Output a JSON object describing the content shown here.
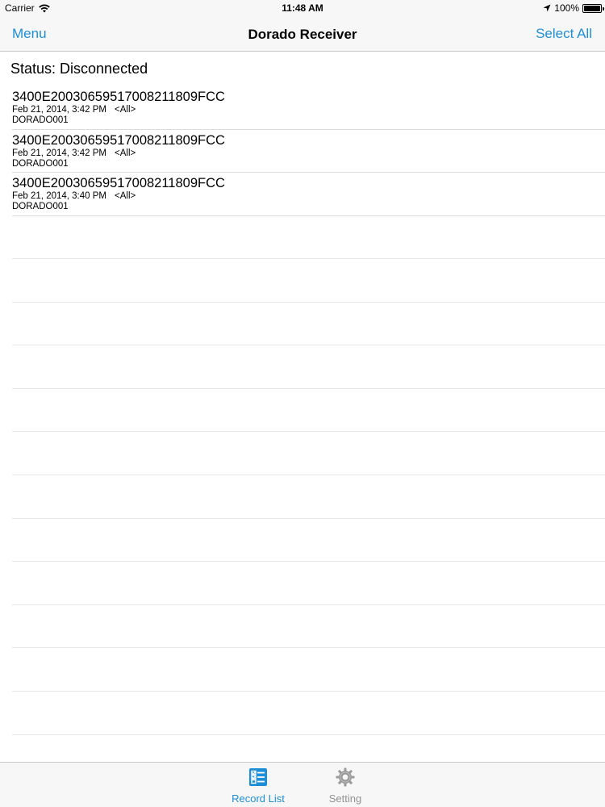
{
  "statusbar": {
    "carrier": "Carrier",
    "time": "11:48 AM",
    "battery": "100%",
    "battery_level": 1.0
  },
  "navbar": {
    "left_label": "Menu",
    "title": "Dorado Receiver",
    "right_label": "Select All"
  },
  "status_line": "Status: Disconnected",
  "records": [
    {
      "id": "3400E2003065951700821​1809FCC",
      "datetime": "Feb 21, 2014, 3:42 PM",
      "tag": "<All>",
      "device": "DORADO001"
    },
    {
      "id": "3400E20030659517008211809FCC",
      "datetime": "Feb 21, 2014, 3:42 PM",
      "tag": "<All>",
      "device": "DORADO001"
    },
    {
      "id": "3400E20030659517008211809FCC",
      "datetime": "Feb 21, 2014, 3:40 PM",
      "tag": "<All>",
      "device": "DORADO001"
    }
  ],
  "tabbar": {
    "record_list": {
      "label": "Record List",
      "icon": "record-list-icon"
    },
    "setting": {
      "label": "Setting",
      "icon": "gear-icon"
    }
  },
  "colors": {
    "accent": "#1e8fd6",
    "inactive": "#929292"
  }
}
